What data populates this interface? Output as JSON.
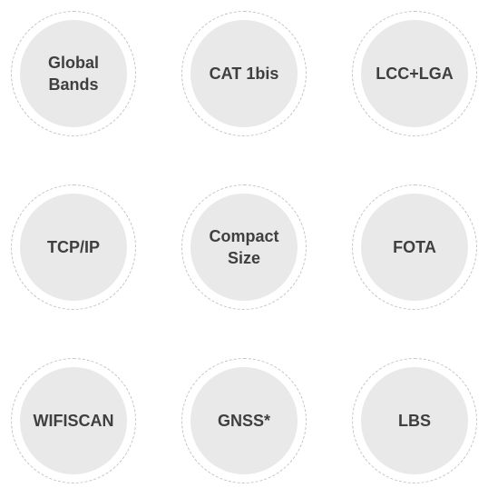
{
  "features": [
    {
      "label": "Global\nBands"
    },
    {
      "label": "CAT 1bis"
    },
    {
      "label": "LCC+LGA"
    },
    {
      "label": "TCP/IP"
    },
    {
      "label": "Compact\nSize"
    },
    {
      "label": "FOTA"
    },
    {
      "label": "WIFISCAN"
    },
    {
      "label": "GNSS*"
    },
    {
      "label": "LBS"
    }
  ],
  "colors": {
    "disc_fill": "#e9e9e9",
    "dashed_ring": "#c4c4c4",
    "text": "#3f3f3f",
    "background": "#ffffff"
  }
}
